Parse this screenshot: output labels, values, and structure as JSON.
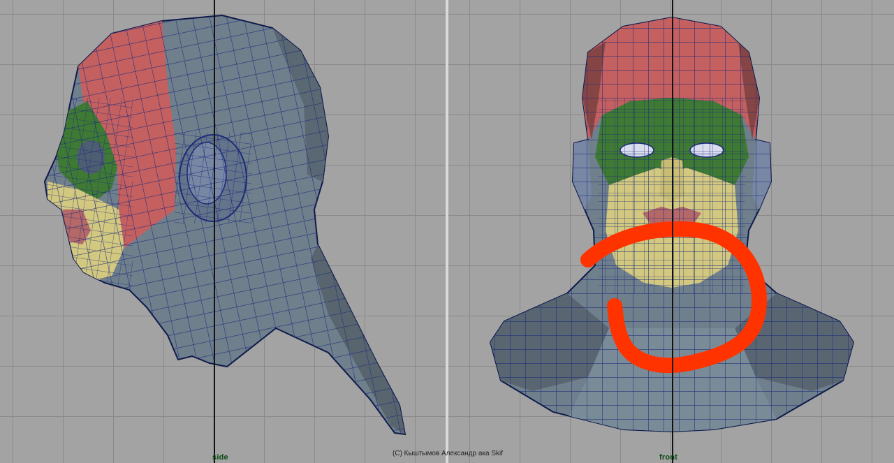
{
  "viewports": {
    "side": {
      "label": "side"
    },
    "front": {
      "label": "front"
    }
  },
  "credit": "(C) Кыштымов Александр ака Skif",
  "colors": {
    "background": "#a3a3a3",
    "grid": "#8a8a8a",
    "mesh_base": "#6f7f8c",
    "wire": "#1c2a78",
    "region_scalp": "#c56060",
    "region_eyes": "#3e7a34",
    "region_mouth": "#d2c880",
    "annotation": "#ff3300"
  },
  "icons": {
    "annotation": "red-circle-annotation-icon"
  }
}
